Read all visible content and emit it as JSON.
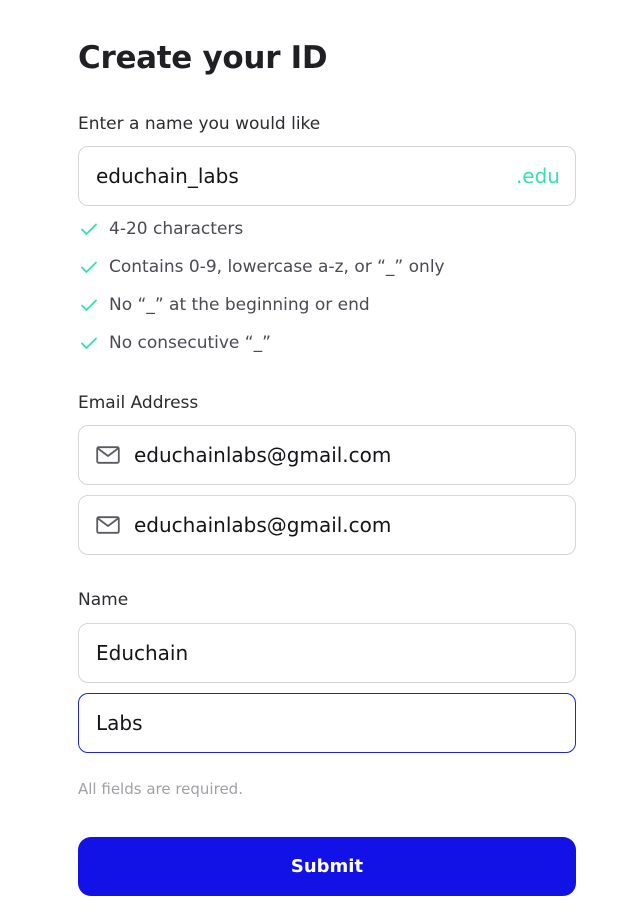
{
  "page": {
    "title": "Create your ID"
  },
  "id_section": {
    "label": "Enter a name you would like",
    "value": "educhain_labs",
    "suffix": ".edu",
    "rules": [
      "4-20 characters",
      "Contains 0-9, lowercase a-z, or “_” only",
      "No “_” at the beginning or end",
      "No consecutive “_”"
    ]
  },
  "email_section": {
    "label": "Email Address",
    "email": "educhainlabs@gmail.com",
    "confirm_email": "educhainlabs@gmail.com"
  },
  "name_section": {
    "label": "Name",
    "first_name": "Educhain",
    "last_name": "Labs"
  },
  "footer": {
    "note": "All fields are required.",
    "submit_label": "Submit"
  },
  "colors": {
    "primary": "#1212e6",
    "accent": "#35dfb8",
    "focus_border": "#1c26d8"
  }
}
